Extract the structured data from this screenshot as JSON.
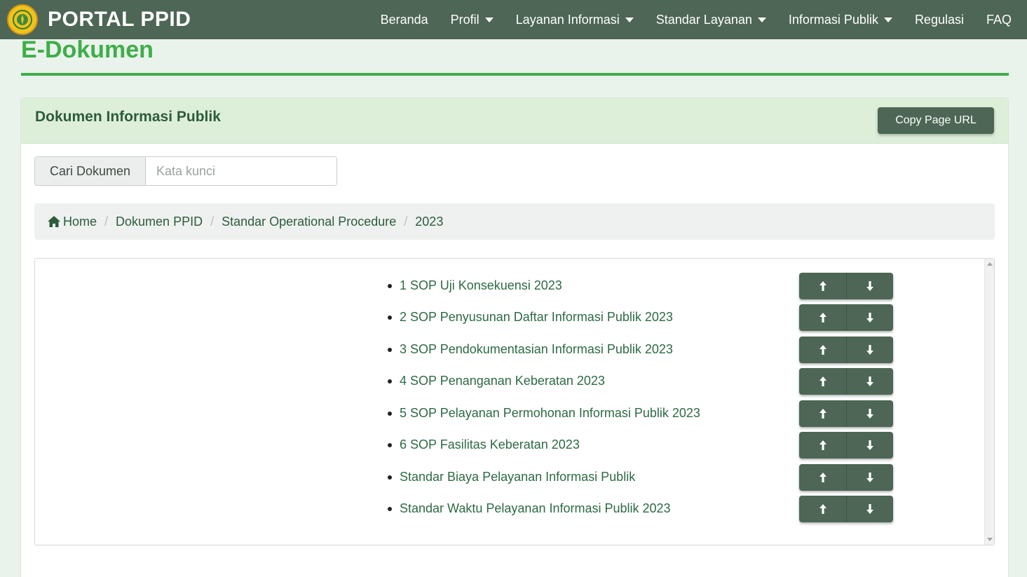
{
  "navbar": {
    "brand": "PORTAL PPID",
    "logo_icon": "kementan-emblem-icon",
    "items": [
      {
        "label": "Beranda",
        "dropdown": false
      },
      {
        "label": "Profil",
        "dropdown": true
      },
      {
        "label": "Layanan Informasi",
        "dropdown": true
      },
      {
        "label": "Standar Layanan",
        "dropdown": true
      },
      {
        "label": "Informasi Publik",
        "dropdown": true
      },
      {
        "label": "Regulasi",
        "dropdown": false
      },
      {
        "label": "FAQ",
        "dropdown": false
      }
    ]
  },
  "page": {
    "title": "E-Dokumen"
  },
  "card": {
    "title": "Dokumen Informasi Publik",
    "copy_button": "Copy Page URL"
  },
  "search": {
    "label": "Cari Dokumen",
    "placeholder": "Kata kunci",
    "value": ""
  },
  "breadcrumb": {
    "items": [
      "Home",
      "Dokumen PPID",
      "Standar Operational Procedure",
      "2023"
    ]
  },
  "documents": [
    "1 SOP Uji Konsekuensi 2023",
    "2 SOP Penyusunan Daftar Informasi Publik 2023",
    "3 SOP Pendokumentasian Informasi Publik 2023",
    "4 SOP Penanganan Keberatan 2023",
    "5 SOP Pelayanan Permohonan Informasi Publik 2023",
    "6 SOP Fasilitas Keberatan 2023",
    "Standar Biaya Pelayanan Informasi Publik",
    "Standar Waktu Pelayanan Informasi Publik 2023"
  ],
  "colors": {
    "navbar": "#4d6655",
    "accent_green": "#3fae49",
    "card_header": "#deefd9",
    "link": "#2d6a43",
    "page_background": "#e9f3ec"
  }
}
